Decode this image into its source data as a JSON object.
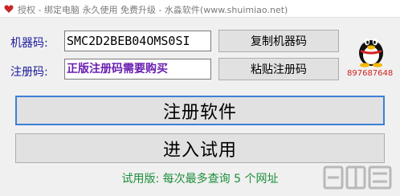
{
  "window": {
    "title": "授权 - 绑定电脑 永久使用 免费升级 - 水淼软件(www.shuimiao.net)",
    "icon": "heart-icon"
  },
  "machine_code": {
    "label": "机器码:",
    "value": "SMC2D2BEB04OMS0SI"
  },
  "reg_code": {
    "label": "注册码:",
    "value": "正版注册码需要购买"
  },
  "buttons": {
    "copy_machine_code": "复制机器码",
    "paste_reg_code": "粘贴注册码",
    "register": "注册软件",
    "trial": "进入试用"
  },
  "qq": {
    "number": "897687648",
    "icon": "qq-penguin-icon"
  },
  "trial_note": "试用版: 每次最多查询 5 个网址",
  "colors": {
    "label": "#1a1a9c",
    "reg_code_text": "#6a1eb0",
    "trial_note": "#1e8f3a",
    "qq_number": "#d42020",
    "focus_border": "#3c7fd6"
  }
}
